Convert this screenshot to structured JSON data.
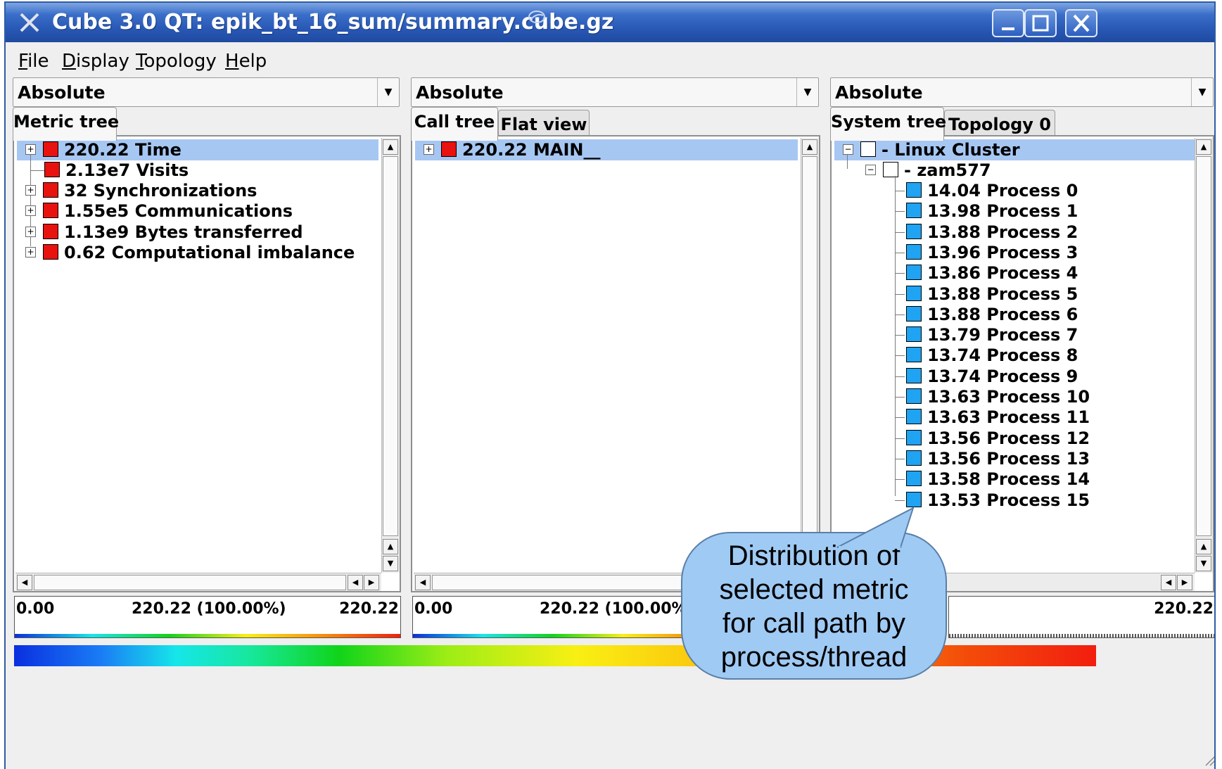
{
  "window": {
    "title": "Cube 3.0 QT: epik_bt_16_sum/summary.cube.gz"
  },
  "menubar": [
    {
      "label": "File"
    },
    {
      "label": "Display"
    },
    {
      "label": "Topology"
    },
    {
      "label": "Help"
    }
  ],
  "metric_pane": {
    "mode": "Absolute",
    "tabs": [
      "Metric tree"
    ],
    "rows": [
      {
        "value": "220.22",
        "label": "Time",
        "selected": true,
        "expandable": true
      },
      {
        "value": "2.13e7",
        "label": "Visits",
        "expandable": false
      },
      {
        "value": "32",
        "label": "Synchronizations",
        "expandable": true
      },
      {
        "value": "1.55e5",
        "label": "Communications",
        "expandable": true
      },
      {
        "value": "1.13e9",
        "label": "Bytes transferred",
        "expandable": true
      },
      {
        "value": "0.62",
        "label": "Computational imbalance",
        "expandable": true
      }
    ],
    "scale": {
      "min": "0.00",
      "mid": "220.22 (100.00%)",
      "max": "220.22"
    }
  },
  "call_pane": {
    "mode": "Absolute",
    "tabs": [
      "Call tree",
      "Flat view"
    ],
    "rows": [
      {
        "value": "220.22",
        "label": "MAIN__",
        "selected": true,
        "expandable": true
      }
    ],
    "scale": {
      "min": "0.00",
      "mid": "220.22 (100.00%)"
    }
  },
  "system_pane": {
    "mode": "Absolute",
    "tabs": [
      "System tree",
      "Topology 0"
    ],
    "cluster": "- Linux Cluster",
    "node": "- zam577",
    "processes": [
      {
        "value": "14.04",
        "label": "Process 0"
      },
      {
        "value": "13.98",
        "label": "Process 1"
      },
      {
        "value": "13.88",
        "label": "Process 2"
      },
      {
        "value": "13.96",
        "label": "Process 3"
      },
      {
        "value": "13.86",
        "label": "Process 4"
      },
      {
        "value": "13.88",
        "label": "Process 5"
      },
      {
        "value": "13.88",
        "label": "Process 6"
      },
      {
        "value": "13.79",
        "label": "Process 7"
      },
      {
        "value": "13.74",
        "label": "Process 8"
      },
      {
        "value": "13.74",
        "label": "Process 9"
      },
      {
        "value": "13.63",
        "label": "Process 10"
      },
      {
        "value": "13.63",
        "label": "Process 11"
      },
      {
        "value": "13.56",
        "label": "Process 12"
      },
      {
        "value": "13.56",
        "label": "Process 13"
      },
      {
        "value": "13.58",
        "label": "Process 14"
      },
      {
        "value": "13.53",
        "label": "Process 15"
      }
    ],
    "scale": {
      "max": "220.22"
    }
  },
  "callout": {
    "lines": [
      "Distribution of",
      "selected metric",
      "for call path by",
      "process/thread"
    ]
  },
  "colors": {
    "metric_red": "#e8120f",
    "process_blue": "#1fa3f3",
    "selection": "#a7c7f3",
    "titlebar": "#2756b3",
    "callout": "#9fcaf4"
  }
}
